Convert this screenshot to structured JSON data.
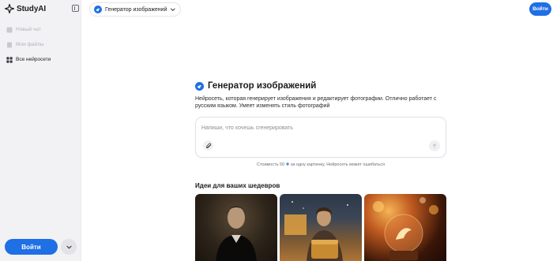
{
  "sidebar": {
    "brand": "StudyAI",
    "items": [
      {
        "label": "Новый чат",
        "state": "disabled",
        "icon": "chat-icon"
      },
      {
        "label": "Мои файлы",
        "state": "disabled",
        "icon": "file-icon"
      },
      {
        "label": "Все нейросети",
        "state": "active",
        "icon": "grid-icon"
      }
    ],
    "login_label": "Войти"
  },
  "header": {
    "model_label": "Генератор изображений",
    "login_label": "Войти"
  },
  "main": {
    "title": "Генератор изображений",
    "description": "Нейросеть, которая генерирует изображения и редактирует фотографии. Отлично работает с русским языком. Умеет изменять стиль фотографий",
    "prompt_placeholder": "Напиши, что хочешь сгенерировать",
    "cost_prefix": "Стоимость 50",
    "cost_suffix": "за одну картинку. Нейросеть может ошибаться",
    "ideas_title": "Идеи для ваших шедевров"
  },
  "colors": {
    "accent": "#1f6fe5",
    "sidebar_bg": "#f2f2f5"
  }
}
